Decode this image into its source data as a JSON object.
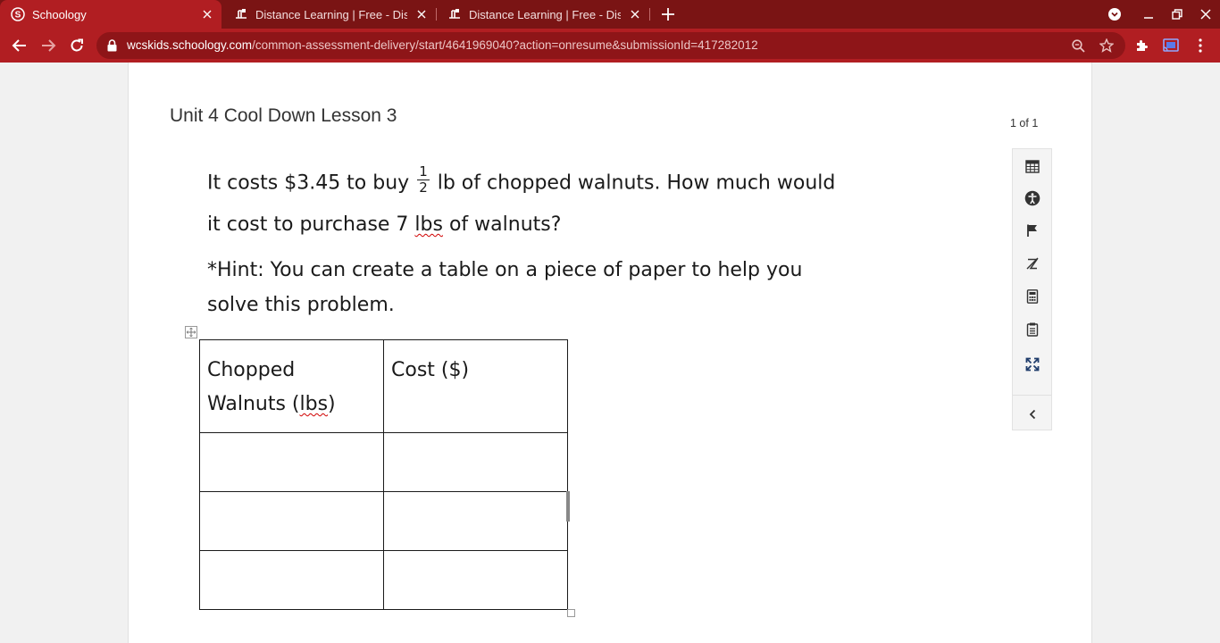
{
  "browser": {
    "tabs": [
      {
        "title": "Schoology",
        "active": true,
        "icon": "schoology-icon"
      },
      {
        "title": "Distance Learning | Free - Distan",
        "active": false,
        "icon": "distance-learning-icon"
      },
      {
        "title": "Distance Learning | Free - Distan",
        "active": false,
        "icon": "distance-learning-icon"
      }
    ],
    "address": {
      "host": "wcskids.schoology.com",
      "path": "/common-assessment-delivery/start/4641969040?action=onresume&submissionId=417282012"
    },
    "colors": {
      "frame": "#7a1414",
      "toolbar": "#b11e22",
      "omnibox": "#8e1518"
    }
  },
  "assessment": {
    "title": "Unit 4 Cool Down Lesson 3",
    "pager": "1 of 1",
    "question": {
      "line1_before": "It costs $3.45 to buy ",
      "fraction_num": "1",
      "fraction_den": "2",
      "line1_after": " lb of chopped walnuts. How much would",
      "line2_before": "it cost to purchase 7 ",
      "line2_lbs": "lbs",
      "line2_after": " of walnuts?",
      "hint_line1": "*Hint:  You can create a table on a piece of paper to help you",
      "hint_line2": "solve this problem."
    },
    "table": {
      "col1_line1": "Chopped",
      "col1_line2_before": "Walnuts (",
      "col1_lbs": "lbs",
      "col1_line2_after": ")",
      "col2": "Cost ($)",
      "rows": [
        [
          "",
          ""
        ],
        [
          "",
          ""
        ],
        [
          "",
          ""
        ]
      ]
    }
  },
  "tools": [
    "calendar-icon",
    "accessibility-icon",
    "flag-icon",
    "strikethrough-icon",
    "calculator-icon",
    "notepad-icon",
    "fullscreen-icon",
    "collapse-chevron-icon"
  ]
}
